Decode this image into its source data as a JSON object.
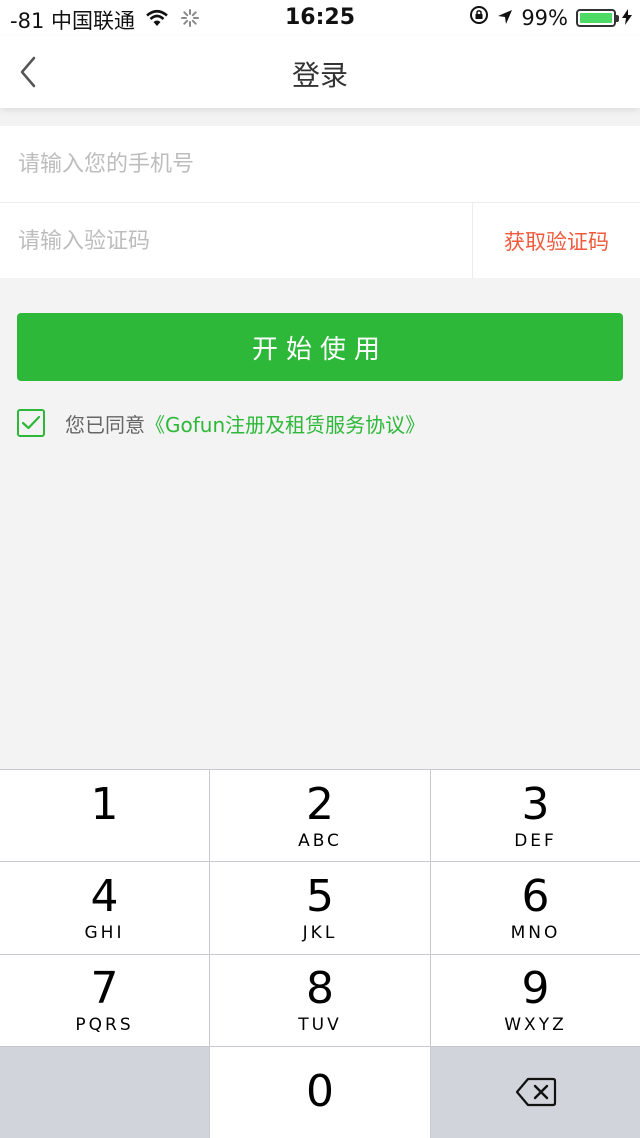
{
  "status_bar": {
    "carrier": "-81 中国联通",
    "time": "16:25",
    "battery": "99%"
  },
  "nav": {
    "title": "登录"
  },
  "form": {
    "phone_placeholder": "请输入您的手机号",
    "code_placeholder": "请输入验证码",
    "get_code_label": "获取验证码"
  },
  "start_button": "开始使用",
  "agreement": {
    "prefix": "您已同意",
    "link": "《Gofun注册及租赁服务协议》",
    "checked": true
  },
  "keypad": {
    "keys": [
      {
        "digit": "1",
        "letters": ""
      },
      {
        "digit": "2",
        "letters": "ABC"
      },
      {
        "digit": "3",
        "letters": "DEF"
      },
      {
        "digit": "4",
        "letters": "GHI"
      },
      {
        "digit": "5",
        "letters": "JKL"
      },
      {
        "digit": "6",
        "letters": "MNO"
      },
      {
        "digit": "7",
        "letters": "PQRS"
      },
      {
        "digit": "8",
        "letters": "TUV"
      },
      {
        "digit": "9",
        "letters": "WXYZ"
      },
      {
        "digit": "0",
        "letters": ""
      }
    ]
  },
  "colors": {
    "accent_green": "#2eb83a",
    "code_red": "#ef5a3c",
    "background": "#f3f3f3"
  }
}
